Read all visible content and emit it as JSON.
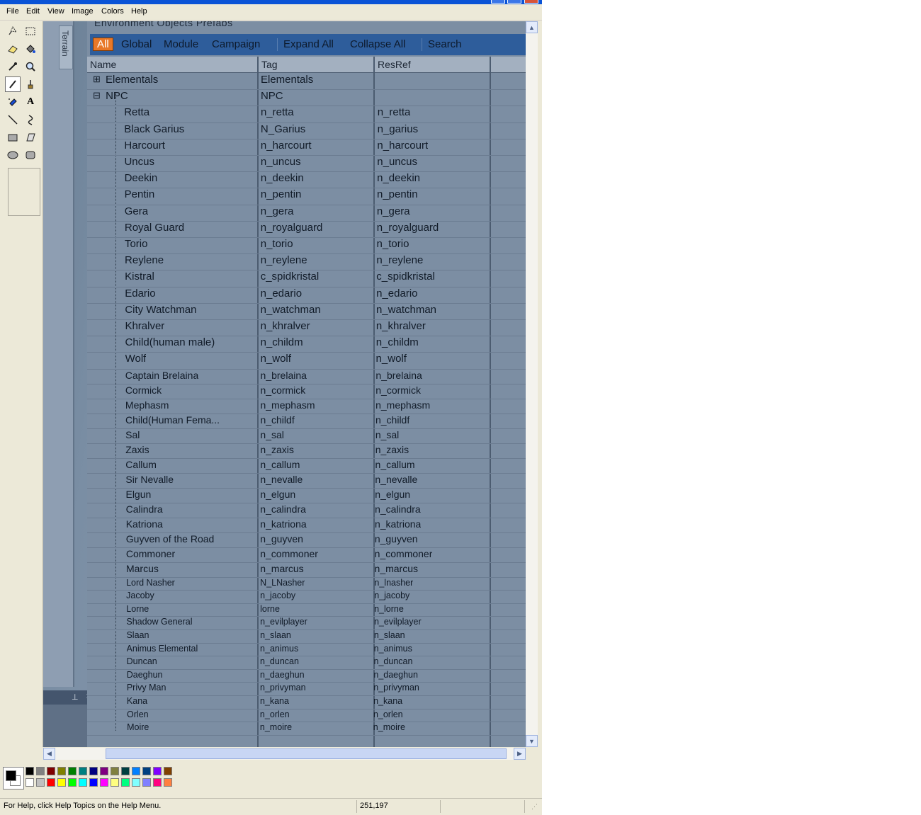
{
  "menu": [
    "File",
    "Edit",
    "View",
    "Image",
    "Colors",
    "Help"
  ],
  "tools": [
    "free-select-icon",
    "rect-select-icon",
    "eraser-icon",
    "fill-icon",
    "eyedropper-icon",
    "magnifier-icon",
    "pencil-icon",
    "brush-icon",
    "airbrush-icon",
    "text-icon",
    "line-icon",
    "curve-icon",
    "rectangle-icon",
    "polygon-icon",
    "ellipse-icon",
    "rounded-rect-icon"
  ],
  "canvas": {
    "side_tab": "Terrain",
    "top_title": "Environment Objects  Prefabs",
    "filters": [
      "All",
      "Global",
      "Module",
      "Campaign",
      "Expand All",
      "Collapse All",
      "Search"
    ],
    "columns": [
      "Name",
      "Tag",
      "ResRef"
    ],
    "rows": [
      {
        "name": "Elementals",
        "tag": "Elementals",
        "resref": "",
        "level": 0
      },
      {
        "name": "NPC",
        "tag": "NPC",
        "resref": "",
        "level": 0
      },
      {
        "name": "Retta",
        "tag": "n_retta",
        "resref": "n_retta",
        "level": 1
      },
      {
        "name": "Black Garius",
        "tag": "N_Garius",
        "resref": "n_garius",
        "level": 1
      },
      {
        "name": "Harcourt",
        "tag": "n_harcourt",
        "resref": "n_harcourt",
        "level": 1
      },
      {
        "name": "Uncus",
        "tag": "n_uncus",
        "resref": "n_uncus",
        "level": 1
      },
      {
        "name": "Deekin",
        "tag": "n_deekin",
        "resref": "n_deekin",
        "level": 1
      },
      {
        "name": "Pentin",
        "tag": "n_pentin",
        "resref": "n_pentin",
        "level": 1
      },
      {
        "name": "Gera",
        "tag": "n_gera",
        "resref": "n_gera",
        "level": 1
      },
      {
        "name": "Royal Guard",
        "tag": "n_royalguard",
        "resref": "n_royalguard",
        "level": 1
      },
      {
        "name": "Torio",
        "tag": "n_torio",
        "resref": "n_torio",
        "level": 1
      },
      {
        "name": "Reylene",
        "tag": "n_reylene",
        "resref": "n_reylene",
        "level": 1
      },
      {
        "name": "Kistral",
        "tag": "c_spidkristal",
        "resref": "c_spidkristal",
        "level": 1
      },
      {
        "name": "Edario",
        "tag": "n_edario",
        "resref": "n_edario",
        "level": 1
      },
      {
        "name": "City Watchman",
        "tag": "n_watchman",
        "resref": "n_watchman",
        "level": 1
      },
      {
        "name": "Khralver",
        "tag": "n_khralver",
        "resref": "n_khralver",
        "level": 1
      },
      {
        "name": "Child(human male)",
        "tag": "n_childm",
        "resref": "n_childm",
        "level": 1
      },
      {
        "name": "Wolf",
        "tag": "n_wolf",
        "resref": "n_wolf",
        "level": 1
      },
      {
        "name": "Captain Brelaina",
        "tag": "n_brelaina",
        "resref": "n_brelaina",
        "level": 1
      },
      {
        "name": "Cormick",
        "tag": "n_cormick",
        "resref": "n_cormick",
        "level": 1
      },
      {
        "name": "Mephasm",
        "tag": "n_mephasm",
        "resref": "n_mephasm",
        "level": 1
      },
      {
        "name": "Child(Human Fema...",
        "tag": "n_childf",
        "resref": "n_childf",
        "level": 1
      },
      {
        "name": "Sal",
        "tag": "n_sal",
        "resref": "n_sal",
        "level": 1
      },
      {
        "name": "Zaxis",
        "tag": "n_zaxis",
        "resref": "n_zaxis",
        "level": 1
      },
      {
        "name": "Callum",
        "tag": "n_callum",
        "resref": "n_callum",
        "level": 1
      },
      {
        "name": "Sir Nevalle",
        "tag": "n_nevalle",
        "resref": "n_nevalle",
        "level": 1
      },
      {
        "name": "Elgun",
        "tag": "n_elgun",
        "resref": "n_elgun",
        "level": 1
      },
      {
        "name": "Calindra",
        "tag": "n_calindra",
        "resref": "n_calindra",
        "level": 1
      },
      {
        "name": "Katriona",
        "tag": "n_katriona",
        "resref": "n_katriona",
        "level": 1
      },
      {
        "name": "Guyven of the Road",
        "tag": "n_guyven",
        "resref": "n_guyven",
        "level": 1
      },
      {
        "name": "Commoner",
        "tag": "n_commoner",
        "resref": "n_commoner",
        "level": 1
      },
      {
        "name": "Marcus",
        "tag": "n_marcus",
        "resref": "n_marcus",
        "level": 1
      },
      {
        "name": "Lord Nasher",
        "tag": "N_LNasher",
        "resref": "n_lnasher",
        "level": 1
      },
      {
        "name": "Jacoby",
        "tag": "n_jacoby",
        "resref": "n_jacoby",
        "level": 1
      },
      {
        "name": "Lorne",
        "tag": "lorne",
        "resref": "n_lorne",
        "level": 1
      },
      {
        "name": "Shadow General",
        "tag": "n_evilplayer",
        "resref": "n_evilplayer",
        "level": 1
      },
      {
        "name": "Slaan",
        "tag": "n_slaan",
        "resref": "n_slaan",
        "level": 1
      },
      {
        "name": "Animus Elemental",
        "tag": "n_animus",
        "resref": "n_animus",
        "level": 1
      },
      {
        "name": "Duncan",
        "tag": "n_duncan",
        "resref": "n_duncan",
        "level": 1
      },
      {
        "name": "Daeghun",
        "tag": "n_daeghun",
        "resref": "n_daeghun",
        "level": 1
      },
      {
        "name": "Privy Man",
        "tag": "n_privyman",
        "resref": "n_privyman",
        "level": 1
      },
      {
        "name": "Kana",
        "tag": "n_kana",
        "resref": "n_kana",
        "level": 1
      },
      {
        "name": "Orlen",
        "tag": "n_orlen",
        "resref": "n_orlen",
        "level": 1
      },
      {
        "name": "Moire",
        "tag": "n_moire",
        "resref": "n_moire",
        "level": 1
      }
    ]
  },
  "palette": {
    "foreground": "#000000",
    "background": "#ffffff",
    "colors_top": [
      "#000000",
      "#808080",
      "#800000",
      "#808000",
      "#008000",
      "#008080",
      "#000080",
      "#800080",
      "#808040",
      "#004040",
      "#0080ff",
      "#004080",
      "#8000ff",
      "#804000"
    ],
    "colors_bottom": [
      "#ffffff",
      "#c0c0c0",
      "#ff0000",
      "#ffff00",
      "#00ff00",
      "#00ffff",
      "#0000ff",
      "#ff00ff",
      "#ffff80",
      "#00ff80",
      "#80ffff",
      "#8080ff",
      "#ff0080",
      "#ff8040"
    ]
  },
  "status": {
    "help_text": "For Help, click Help Topics on the Help Menu.",
    "coords": "251,197"
  }
}
